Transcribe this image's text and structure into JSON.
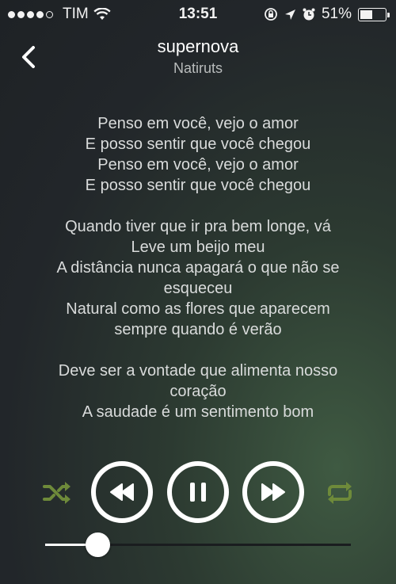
{
  "status_bar": {
    "carrier": "TIM",
    "time": "13:51",
    "battery_percent": "51%",
    "battery_level": 0.51,
    "signal_bars": 4,
    "signal_total": 5
  },
  "header": {
    "title": "supernova",
    "artist": "Natiruts"
  },
  "lyrics": {
    "stanzas": [
      [
        "Penso em você, vejo o amor",
        "E posso sentir que você chegou",
        "Penso em você, vejo o amor",
        "E posso sentir que você chegou"
      ],
      [
        "Quando tiver que ir pra bem longe, vá",
        "Leve um beijo meu",
        "A distância nunca apagará o que não se",
        "esqueceu",
        "Natural como as flores que aparecem",
        "sempre quando é verão"
      ],
      [
        "Deve ser a vontade que alimenta nosso",
        "coração",
        "A saudade é um sentimento bom"
      ]
    ]
  },
  "controls": {
    "accent_color": "#6e8a3a",
    "icons": [
      "chevron-left-icon",
      "shuffle-icon",
      "rewind-icon",
      "pause-icon",
      "fast-forward-icon",
      "repeat-icon"
    ]
  },
  "playback": {
    "progress": 0.17
  }
}
